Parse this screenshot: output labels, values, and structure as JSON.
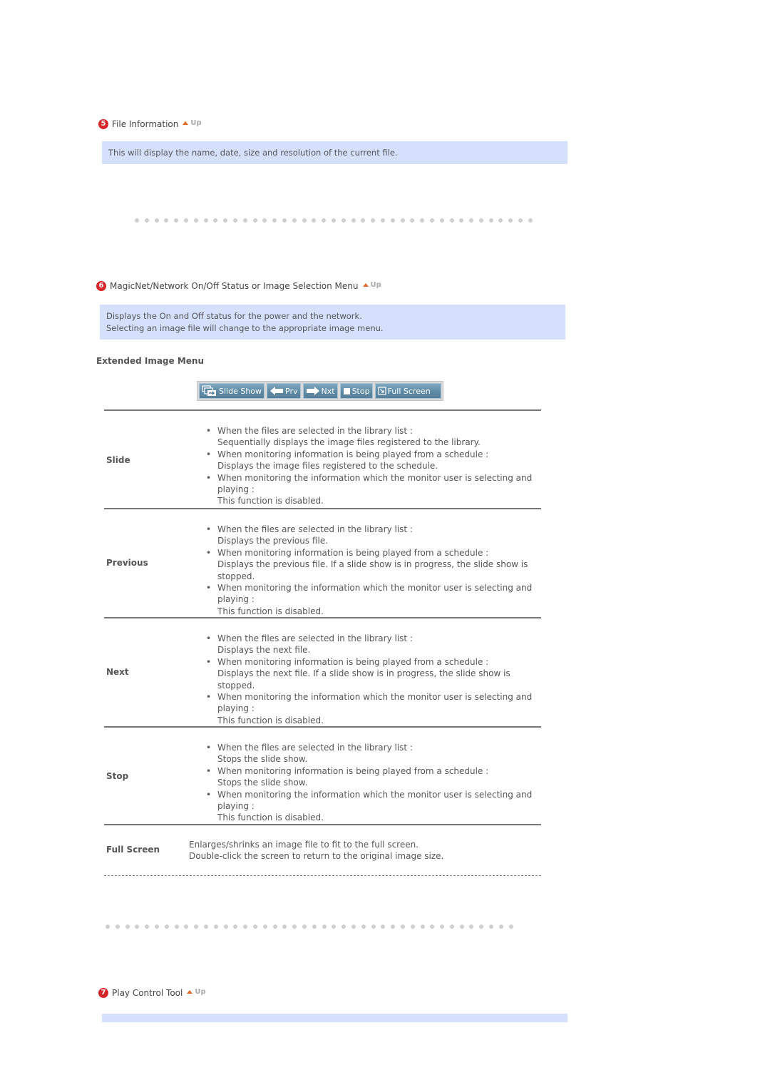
{
  "sections": [
    {
      "number": "5",
      "title": "File Information",
      "up_label": "Up",
      "description": [
        "This will display the name, date, size and resolution of the current file."
      ]
    },
    {
      "number": "6",
      "title": "MagicNet/Network On/Off Status or Image Selection Menu",
      "up_label": "Up",
      "description": [
        "Displays the On and Off status for the power and the network.",
        "Selecting an image file will change to the appropriate image menu."
      ]
    },
    {
      "number": "7",
      "title": "Play Control Tool",
      "up_label": "Up",
      "description": []
    }
  ],
  "extended_menu": {
    "heading": "Extended Image Menu",
    "toolbar": [
      {
        "label": "Slide Show",
        "icon": "slideshow-icon"
      },
      {
        "label": "Prv",
        "icon": "arrow-left-icon"
      },
      {
        "label": "Nxt",
        "icon": "arrow-right-icon"
      },
      {
        "label": "Stop",
        "icon": "stop-icon"
      },
      {
        "label": "Full Screen",
        "icon": "fullscreen-icon"
      }
    ],
    "rows": [
      {
        "label": "Slide",
        "items": [
          {
            "bullet": "When the files are selected in the library list :",
            "text": "Sequentially displays the image files registered to the library."
          },
          {
            "bullet": "When monitoring information is being played from a schedule :",
            "text": "Displays the image files registered to the schedule."
          },
          {
            "bullet": "When monitoring the information which the monitor user is selecting and playing :",
            "text": "This function is disabled."
          }
        ]
      },
      {
        "label": "Previous",
        "items": [
          {
            "bullet": "When the files are selected in the library list :",
            "text": "Displays the previous file."
          },
          {
            "bullet": "When monitoring information is being played from a schedule :",
            "text": "Displays the previous file. If a slide show is in progress, the slide show is stopped."
          },
          {
            "bullet": "When monitoring the information which the monitor user is selecting and playing :",
            "text": "This function is disabled."
          }
        ]
      },
      {
        "label": "Next",
        "items": [
          {
            "bullet": "When the files are selected in the library list :",
            "text": "Displays the next file."
          },
          {
            "bullet": "When monitoring information is being played from a schedule :",
            "text": "Displays the next file. If a slide show is in progress, the slide show is stopped."
          },
          {
            "bullet": "When monitoring the information which the monitor user is selecting and playing :",
            "text": "This function is disabled."
          }
        ]
      },
      {
        "label": "Stop",
        "items": [
          {
            "bullet": "When the files are selected in the library list :",
            "text": "Stops the slide show."
          },
          {
            "bullet": "When monitoring information is being played from a schedule :",
            "text": "Stops the slide show."
          },
          {
            "bullet": "When monitoring the information which the monitor user is selecting and playing :",
            "text": "This function is disabled."
          }
        ]
      }
    ],
    "full_screen": {
      "label": "Full Screen",
      "lines": [
        "Enlarges/shrinks an image file to fit to the full screen.",
        "Double-click the screen to return to the original image size."
      ]
    }
  },
  "colors": {
    "info_box_bg": "#d5e0fd",
    "badge_red": "#d6262b",
    "up_arrow": "#e0662a",
    "toolbar_button": "#5f8aa5"
  }
}
